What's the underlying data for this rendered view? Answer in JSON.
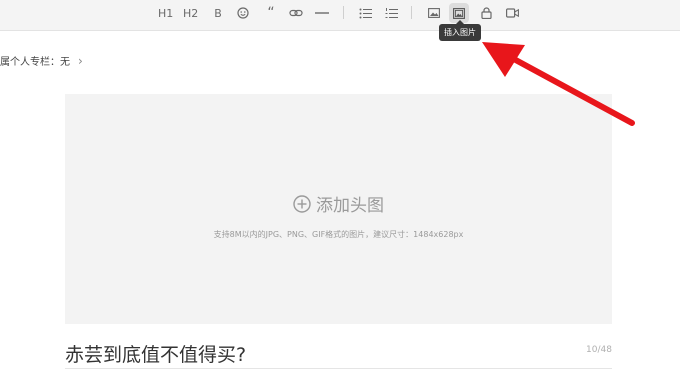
{
  "toolbar": {
    "h1": "H1",
    "h2": "H2",
    "bold": "B",
    "quote": "“",
    "icons": [
      "h1-icon",
      "h2-icon",
      "bold-icon",
      "emoji-icon",
      "quote-icon",
      "link-icon",
      "divider-icon",
      "unordered-list-icon",
      "ordered-list-icon",
      "image-icon",
      "insert-image-icon",
      "lock-icon",
      "video-icon"
    ]
  },
  "tooltip": {
    "text": "插入图片"
  },
  "column": {
    "label": "属个人专栏：无",
    "chevron": "›"
  },
  "cover": {
    "add_label": "添加头图",
    "hint": "支持8M以内的JPG、PNG、GIF格式的图片，建议尺寸：1484x628px"
  },
  "article": {
    "title": "赤芸到底值不值得买?",
    "count": "10/48"
  },
  "annotation": {
    "arrow_color": "#e8161b"
  }
}
